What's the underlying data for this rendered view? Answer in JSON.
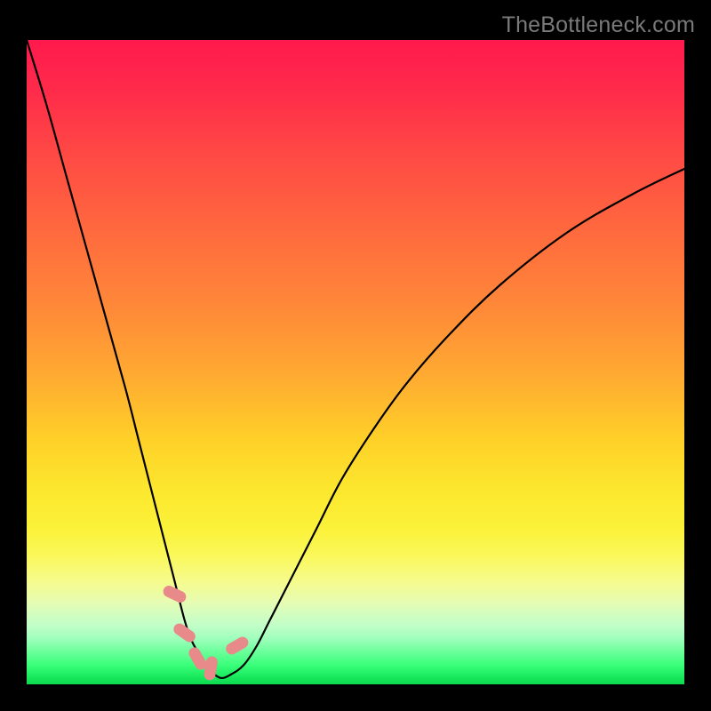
{
  "watermark": "TheBottleneck.com",
  "colors": {
    "frame": "#000000",
    "curve": "#000000",
    "marker": "#e88a8a",
    "gradient_stops": [
      "#ff1a4d",
      "#ff6a3e",
      "#ffd028",
      "#faf85a",
      "#16e85a"
    ]
  },
  "chart_data": {
    "type": "line",
    "title": "",
    "xlabel": "",
    "ylabel": "",
    "xlim": [
      0,
      100
    ],
    "ylim": [
      0,
      100
    ],
    "grid": false,
    "legend": false,
    "note": "No axis ticks or labels are visible in the image; x and y scales are normalized to 0-100 based on plot area. y=0 at bottom (green), y=100 at top (red).",
    "series": [
      {
        "name": "curve",
        "x": [
          0,
          3,
          6,
          9,
          12,
          15,
          17,
          19,
          21,
          22.5,
          24,
          25,
          26,
          27,
          28,
          29.5,
          31,
          33,
          35,
          37,
          40,
          44,
          48,
          53,
          58,
          64,
          72,
          82,
          92,
          100
        ],
        "y": [
          100,
          90,
          79,
          68,
          57,
          46,
          38,
          30,
          22,
          16,
          10,
          7,
          5,
          3,
          2,
          1,
          1.5,
          3,
          6,
          10,
          16,
          24,
          32,
          40,
          47,
          54,
          62,
          70,
          76,
          80
        ]
      }
    ],
    "markers": [
      {
        "x": 22.5,
        "y": 14,
        "rotation_deg": -65
      },
      {
        "x": 24,
        "y": 8,
        "rotation_deg": -55
      },
      {
        "x": 26,
        "y": 4,
        "rotation_deg": -30
      },
      {
        "x": 28,
        "y": 2.5,
        "rotation_deg": 10
      },
      {
        "x": 32,
        "y": 6,
        "rotation_deg": 60
      }
    ],
    "marker_shape": "rounded-capsule"
  }
}
